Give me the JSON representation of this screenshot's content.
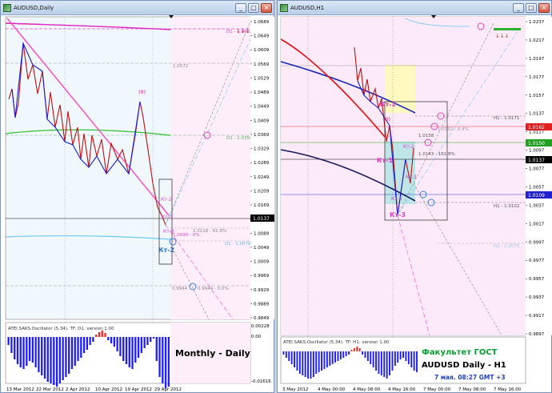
{
  "left": {
    "title": "AUDUSD,Daily",
    "price_ticks": [
      "1.0689",
      "1.0649",
      "1.0609",
      "1.0569",
      "1.0529",
      "1.0489",
      "1.0449",
      "1.0409",
      "1.0369",
      "1.0329",
      "1.0289",
      "1.0249",
      "1.0209",
      "1.0169",
      "1.0129",
      "1.0089",
      "1.0049",
      "1.0009",
      "0.9969",
      "0.9929",
      "0.9889",
      "0.9849"
    ],
    "current_price": "1.0137",
    "date_ticks": [
      "13 Mar 2012",
      "22 Mar 2012",
      "2 Apr 2012",
      "10 Apr 2012",
      "19 Apr 2012",
      "29 Apr 2012"
    ],
    "level_labels": {
      "d1_top": "D1 - 1.0682",
      "l_1_0572": "1.0572",
      "d1_mid": "D1 - 1.0358",
      "fib_618": "1.0118 - 61.8%",
      "fib_1": "1.0090 - 0%",
      "d1_low": "D1 - 1.0078",
      "fib_low_a": "0.9944",
      "fib_low_b": "0.9944 - 0.0%"
    },
    "wave_labels": {
      "zero": "(0)",
      "kt2_small": "Кт-2",
      "kt1": "Кт-1",
      "kt3": "Кт-3",
      "kt2_big": "Кт-2"
    },
    "osc_title": "ATEI.SAKS.Oscillator (5,34). TF: D1. version 1.00",
    "osc_ticks": [
      "0.00228",
      "0.00",
      "-0.01616"
    ],
    "caption": "Monthly - Daily"
  },
  "right": {
    "title": "AUDUSD,H1",
    "price_ticks": [
      "1.0237",
      "1.0217",
      "1.0197",
      "1.0177",
      "1.0157",
      "1.0137",
      "1.0117",
      "1.0097",
      "1.0077",
      "1.0057",
      "1.0037",
      "1.0017",
      "0.9997",
      "0.9977",
      "0.9957",
      "0.9937",
      "0.9917",
      "0.9897"
    ],
    "tag_1_0162": "1.0162",
    "tag_1_0150": "1.0150",
    "tag_1_0137": "1.0137",
    "tag_1_0109": "1.0109",
    "date_ticks": [
      "3 May 2012",
      "4 May 00:00",
      "4 May 08:00",
      "4 May 16:00",
      "7 May 00:00",
      "7 May 08:00",
      "7 May 16:00"
    ],
    "level_labels": {
      "h1_top": "H1 - 1.0171",
      "fib_404": "1.0152 - 0.4%",
      "l_1_0158": "1.0158",
      "fib_1618": "1.0143 - 161.8%",
      "h1_low": "H1 - 1.0102",
      "h1_far": "H1 - 1.0075"
    },
    "wave_labels": {
      "kt2_top": "Кт-2",
      "zero": "(0)",
      "kt1": "Кт-1",
      "kt2": "Кт-2",
      "kt3": "Кт-3",
      "kt4": "Кт-4",
      "kt3_big": "Кт-3"
    },
    "osc_title": "ATEI.SAKS.Oscillator (5,34). TF: H1. version 1.00",
    "brand": "Факультет ГОСТ",
    "caption": "AUDUSD Daily - H1",
    "timestamp": "7 мая. 08:27 GMT +3"
  },
  "colors": {
    "chart_bg": "#fdf0fb",
    "osc_up": "#ff2020",
    "osc_down": "#1c1cff",
    "accent_magenta": "#ff44c8",
    "brand_green": "#08a030"
  }
}
